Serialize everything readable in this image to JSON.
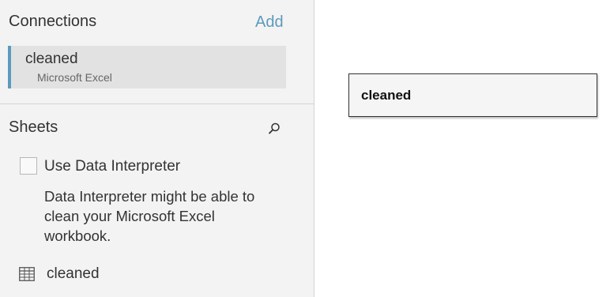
{
  "connections": {
    "title": "Connections",
    "add_label": "Add",
    "items": [
      {
        "name": "cleaned",
        "type": "Microsoft Excel"
      }
    ]
  },
  "sheets": {
    "title": "Sheets",
    "search_icon": "search-icon",
    "data_interpreter": {
      "label": "Use Data Interpreter",
      "checked": false,
      "description": "Data Interpreter might be able to clean your Microsoft Excel workbook."
    },
    "items": [
      {
        "name": "cleaned",
        "icon": "table-icon"
      }
    ]
  },
  "canvas": {
    "tables": [
      {
        "name": "cleaned"
      }
    ]
  },
  "colors": {
    "accent": "#5b9bbd",
    "sidebar_bg": "#f3f3f3",
    "selected_bg": "#e2e2e2"
  }
}
